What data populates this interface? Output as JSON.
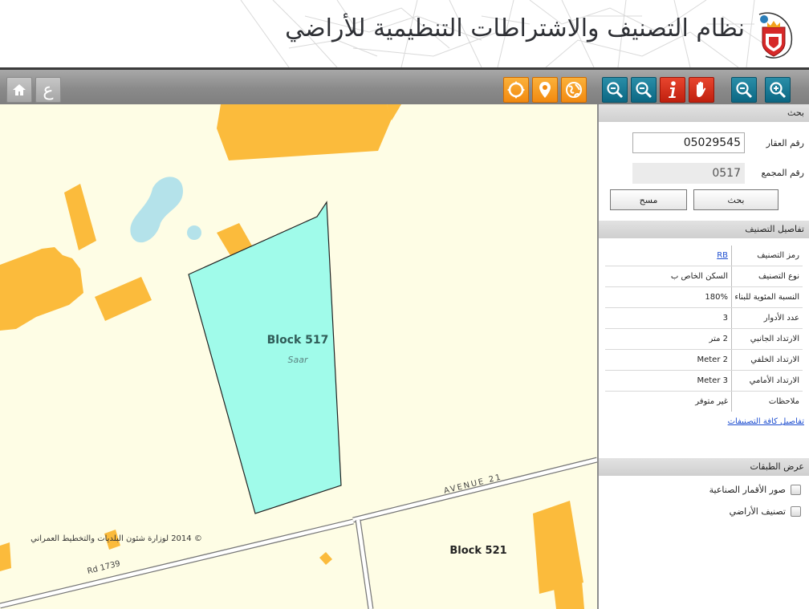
{
  "header": {
    "title": "نظام التصنيف والاشتراطات التنظيمية للأراضي",
    "logo_icon": "bahrain-emblem-icon"
  },
  "toolbar": {
    "left_buttons": [
      {
        "icon": "home-icon"
      },
      {
        "icon": "arabic-letter-ain-icon",
        "label": "ع"
      }
    ],
    "right_buttons": [
      {
        "icon": "pan-extent-icon",
        "color": "#f39a1e"
      },
      {
        "icon": "map-pin-icon",
        "color": "#f39a1e"
      },
      {
        "icon": "globe-icon",
        "color": "#f39a1e"
      },
      {
        "icon": "zoom-out-box-icon",
        "color": "#167894"
      },
      {
        "icon": "zoom-out-box-icon",
        "color": "#167894"
      },
      {
        "icon": "info-icon",
        "color": "#d3321c"
      },
      {
        "icon": "pan-hand-icon",
        "color": "#d3321c"
      },
      {
        "icon": "zoom-out-icon",
        "color": "#167894"
      },
      {
        "icon": "zoom-in-icon",
        "color": "#167894"
      }
    ]
  },
  "map": {
    "block_517_label": "Block 517",
    "block_517_sub": "Saar",
    "block_521_label": "Block 521",
    "avenue_label": "AVENUE 21",
    "road_label": "Rd 1739",
    "copyright": "© 2014 لوزارة شئون البلديات والتخطيط العمراني",
    "parcel_color": "#a0fbea",
    "building_color": "#fbbb3c",
    "water_color": "#b4e2ea"
  },
  "panel": {
    "search": {
      "heading": "بحث",
      "property_label": "رقم العقار",
      "property_value": "05029545",
      "block_label": "رقم المجمع",
      "block_value": "0517",
      "search_button": "بحث",
      "clear_button": "مسح"
    },
    "classification": {
      "heading": "تفاصيل التصنيف",
      "rows": [
        {
          "label": "رمز التصنيف",
          "value": "RB",
          "link": true
        },
        {
          "label": "نوع التصنيف",
          "value": "السكن الخاص ب"
        },
        {
          "label": "النسبة المئوية للبناء",
          "value": "180%"
        },
        {
          "label": "عدد الأدوار",
          "value": "3"
        },
        {
          "label": "الارتداد الجانبي",
          "value": "2 متر"
        },
        {
          "label": "الارتداد الخلفي",
          "value": "Meter 2"
        },
        {
          "label": "الارتداد الأمامي",
          "value": "Meter 3"
        },
        {
          "label": "ملاحظات",
          "value": "غير متوفر"
        }
      ],
      "all_link": "تفاصيل كافة التصنيفات"
    },
    "layers": {
      "heading": "عرض الطبقات",
      "items": [
        {
          "label": "صور الأقمار الصناعية",
          "checked": false
        },
        {
          "label": "تصنيف الأراضي",
          "checked": false
        }
      ]
    }
  }
}
